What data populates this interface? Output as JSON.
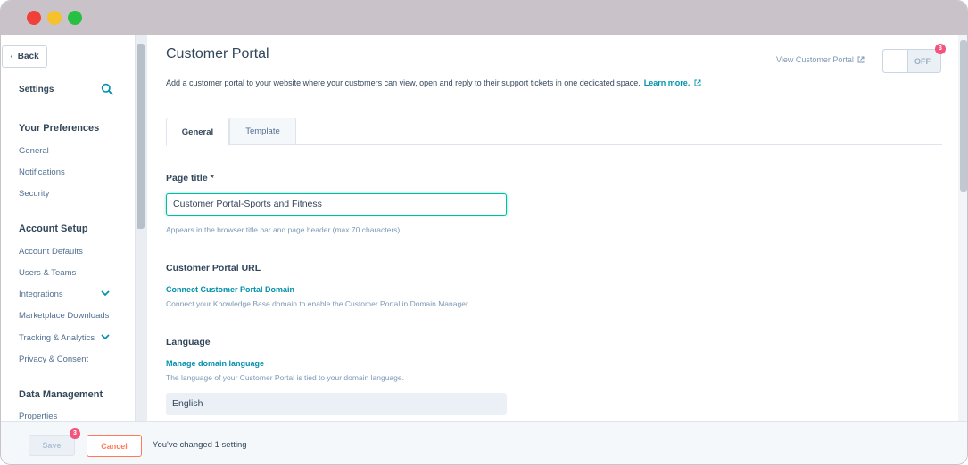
{
  "sidebar": {
    "back_label": "Back",
    "settings_label": "Settings",
    "sections": {
      "preferences": "Your Preferences",
      "account_setup": "Account Setup",
      "data_management": "Data Management"
    },
    "items": {
      "general": "General",
      "notifications": "Notifications",
      "security": "Security",
      "account_defaults": "Account Defaults",
      "users_teams": "Users & Teams",
      "integrations": "Integrations",
      "marketplace_downloads": "Marketplace Downloads",
      "tracking_analytics": "Tracking & Analytics",
      "privacy_consent": "Privacy & Consent",
      "properties": "Properties"
    }
  },
  "header": {
    "title": "Customer Portal",
    "description": "Add a customer portal to your website where your customers can view, open and reply to their support tickets in one dedicated space.",
    "learn_more": "Learn more.",
    "view_link": "View Customer Portal",
    "toggle_label": "OFF",
    "toggle_badge": "3"
  },
  "tabs": {
    "general": "General",
    "template": "Template"
  },
  "form": {
    "page_title_label": "Page title *",
    "page_title_value": "Customer Portal-Sports and Fitness",
    "page_title_help": "Appears in the browser title bar and page header (max 70 characters)",
    "url_label": "Customer Portal URL",
    "connect_link": "Connect Customer Portal Domain",
    "connect_help": "Connect your Knowledge Base domain to enable the Customer Portal in Domain Manager.",
    "language_label": "Language",
    "manage_language_link": "Manage domain language",
    "language_help": "The language of your Customer Portal is tied to your domain language.",
    "language_value": "English"
  },
  "footer": {
    "save_label": "Save",
    "save_badge": "3",
    "cancel_label": "Cancel",
    "changed_text": "You've changed 1 setting"
  },
  "colors": {
    "accent": "#0091ae",
    "focus": "#00bda5",
    "cancel": "#ff7a59",
    "badge": "#f2547d",
    "text": "#33475b"
  }
}
